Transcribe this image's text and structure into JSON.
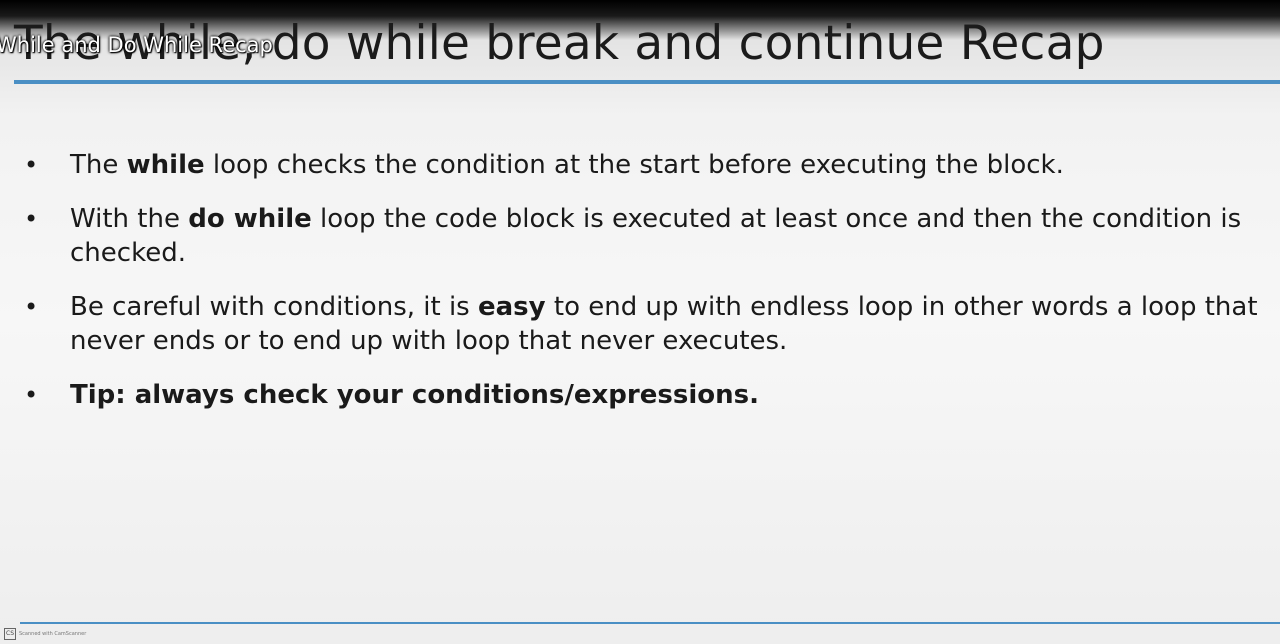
{
  "slide": {
    "title": "The while, do while break and continue Recap",
    "overlay_caption": "While and Do While Recap",
    "bullets": [
      {
        "before": "The ",
        "strong": "while",
        "after": " loop checks the condition at the start before executing the block."
      },
      {
        "before": "With the ",
        "strong": "do while",
        "after": " loop the code block is executed at least once and then the condition is checked."
      },
      {
        "before": "Be careful with conditions, it is ",
        "strong": "easy",
        "after": " to end up with endless loop in other words a loop that never ends or to end up with loop that never executes."
      },
      {
        "before": "",
        "strong": "Tip: always check your conditions/expressions",
        "after": "."
      }
    ],
    "bullet_symbol": "•"
  },
  "watermark": {
    "logo": "CS",
    "text": "Scanned with CamScanner"
  },
  "colors": {
    "accent_rule": "#4a8fc4",
    "text": "#1a1a1a"
  }
}
